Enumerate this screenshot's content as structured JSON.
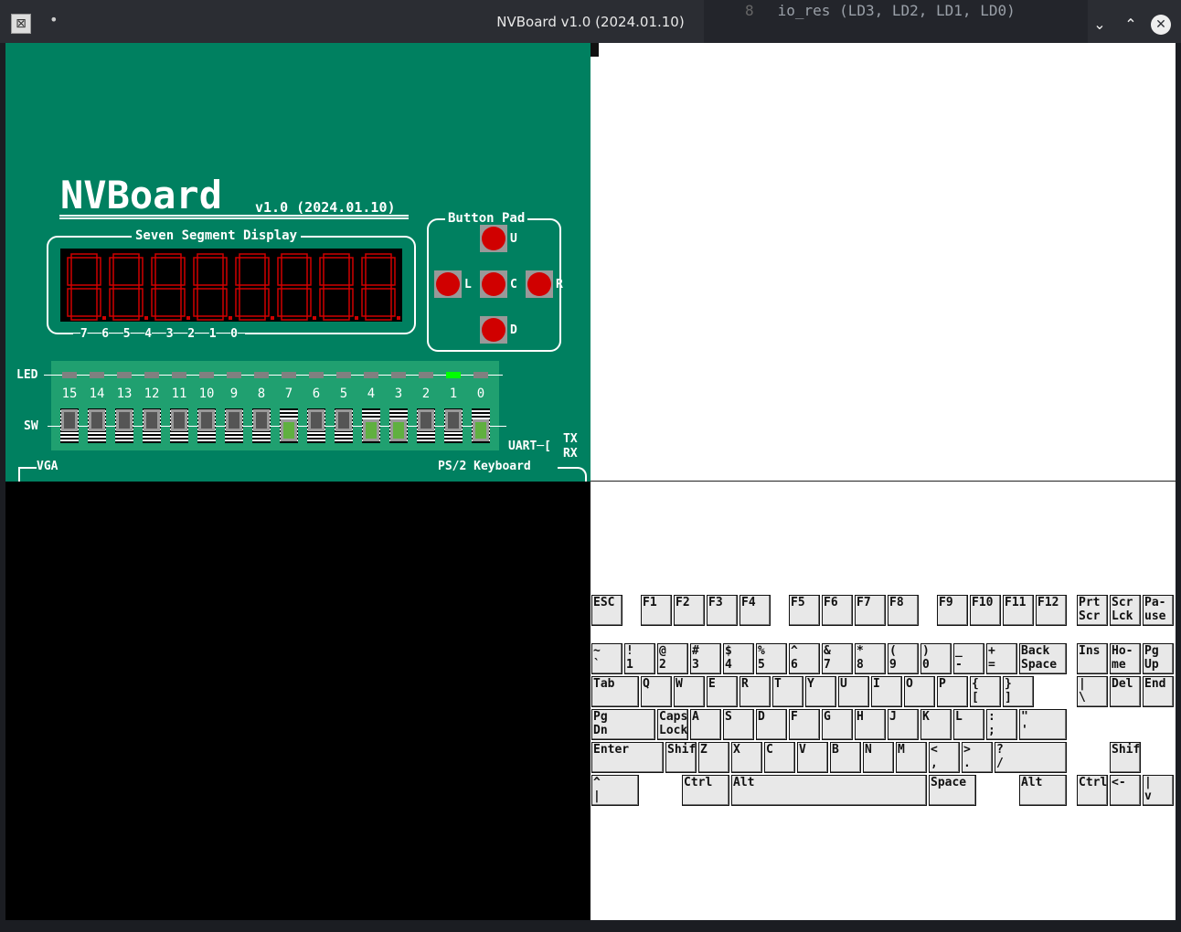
{
  "window": {
    "title": "NVBoard v1.0 (2024.01.10)",
    "code_line_no": "8",
    "code_text": "io_res (LD3, LD2, LD1, LD0)",
    "app_icon": "x-app-icon",
    "menu_dot": "•"
  },
  "board": {
    "logo": "NVBoard",
    "version": "v1.0 (2024.01.10)",
    "seg_title": "Seven Segment Display",
    "seg_axis": "─7──6──5──4──3──2──1──0─",
    "btnpad_title": "Button Pad",
    "buttons": {
      "up": "U",
      "left": "L",
      "center": "C",
      "right": "R",
      "down": "D"
    },
    "led_label": "LED",
    "sw_label": "SW",
    "indices": [
      "15",
      "14",
      "13",
      "12",
      "11",
      "10",
      "9",
      "8",
      "7",
      "6",
      "5",
      "4",
      "3",
      "2",
      "1",
      "0"
    ],
    "leds_on": [
      false,
      false,
      false,
      false,
      false,
      false,
      false,
      false,
      false,
      false,
      false,
      false,
      false,
      false,
      true,
      false
    ],
    "switches_on": [
      false,
      false,
      false,
      false,
      false,
      false,
      false,
      false,
      true,
      false,
      false,
      true,
      true,
      false,
      false,
      true
    ],
    "uart": "UART─[",
    "tx": "TX",
    "rx": "RX",
    "vga": "VGA",
    "ps2": "PS/2 Keyboard",
    "colors": {
      "board": "#008060",
      "seg_on": "#d00000",
      "led_on": "#00ff00",
      "led_off": "#808080",
      "sw_on": "#60b040"
    }
  },
  "keyboard": {
    "keys": [
      "ESC",
      "F1",
      "F2",
      "F3",
      "F4",
      "F5",
      "F6",
      "F7",
      "F8",
      "F9",
      "F10",
      "F11",
      "F12",
      "Prt\nScr",
      "Scr\nLck",
      "Pa-\nuse",
      "~\n`",
      "!\n1",
      "@\n2",
      "#\n3",
      "$\n4",
      "%\n5",
      "^\n6",
      "&\n7",
      "*\n8",
      "(\n9",
      ")\n0",
      "_\n-",
      "+\n=",
      "Back\nSpace",
      "Ins",
      "Ho-\nme",
      "Pg\nUp",
      "Tab",
      "Q",
      "W",
      "E",
      "R",
      "T",
      "Y",
      "U",
      "I",
      "O",
      "P",
      "{\n[",
      "}\n]",
      "|\n\\",
      "Del",
      "End",
      "Pg\nDn",
      "Caps\nLock",
      "A",
      "S",
      "D",
      "F",
      "G",
      "H",
      "J",
      "K",
      "L",
      ":\n;",
      "\"\n'",
      "Enter",
      "Shift",
      "Z",
      "X",
      "C",
      "V",
      "B",
      "N",
      "M",
      "<\n,",
      ">\n.",
      "?\n/",
      "Shift",
      "^\n|",
      "Ctrl",
      "Alt",
      "Space",
      "Alt",
      "Ctrl",
      "<-",
      "|\nv",
      "->"
    ]
  }
}
